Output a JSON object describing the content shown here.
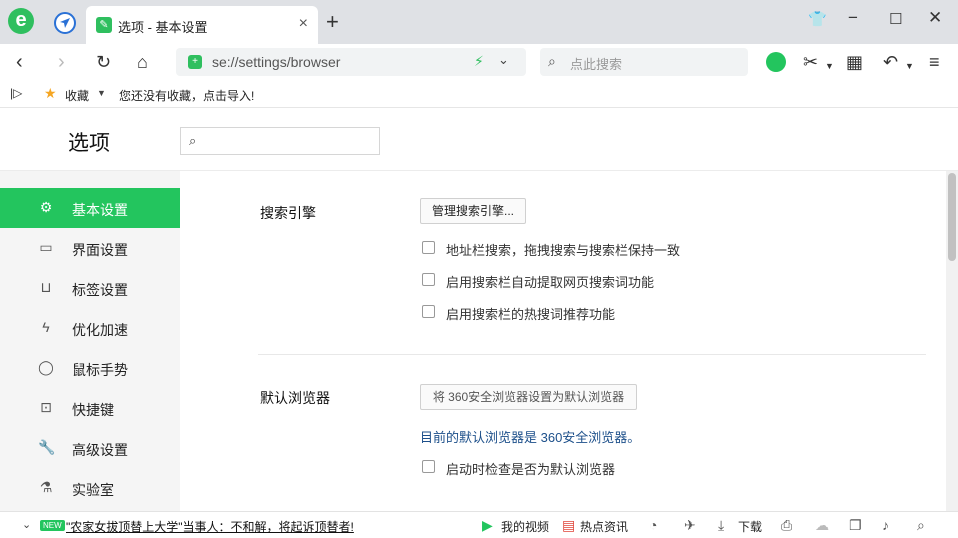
{
  "browser": {
    "tab_title": "选项 - 基本设置",
    "tab_close": "×",
    "new_tab": "+",
    "url": "se://settings/browser",
    "search_placeholder": "点此搜索"
  },
  "bookmarks": {
    "favorites_label": "收藏",
    "empty_message": "您还没有收藏，点击导入!"
  },
  "page": {
    "title": "选项",
    "search_placeholder": ""
  },
  "sidebar": {
    "items": [
      {
        "label": "基本设置",
        "icon": "settings-icon",
        "active": true
      },
      {
        "label": "界面设置",
        "icon": "window-icon",
        "active": false
      },
      {
        "label": "标签设置",
        "icon": "tab-icon",
        "active": false
      },
      {
        "label": "优化加速",
        "icon": "bolt-icon",
        "active": false
      },
      {
        "label": "鼠标手势",
        "icon": "mouse-icon",
        "active": false
      },
      {
        "label": "快捷键",
        "icon": "keyboard-icon",
        "active": false
      },
      {
        "label": "高级设置",
        "icon": "wrench-icon",
        "active": false
      },
      {
        "label": "实验室",
        "icon": "flask-icon",
        "active": false
      }
    ]
  },
  "search_engine": {
    "title": "搜索引擎",
    "manage_button": "管理搜索引擎...",
    "options": [
      {
        "label": "地址栏搜索，拖拽搜索与搜索栏保持一致",
        "checked": false
      },
      {
        "label": "启用搜索栏自动提取网页搜索词功能",
        "checked": false
      },
      {
        "label": "启用搜索栏的热搜词推荐功能",
        "checked": false
      }
    ]
  },
  "default_browser": {
    "title": "默认浏览器",
    "set_button": "将 360安全浏览器设置为默认浏览器",
    "status": "目前的默认浏览器是 360安全浏览器。",
    "check_option": {
      "label": "启动时检查是否为默认浏览器",
      "checked": false
    }
  },
  "statusbar": {
    "new_badge": "NEW",
    "news": "\"农家女拔顶替上大学\"当事人：不和解，将起诉顶替者!",
    "video": "我的视频",
    "hot": "热点资讯",
    "download": "下载"
  },
  "colors": {
    "accent": "#23c55e",
    "link_blue": "#1c4f8a"
  }
}
